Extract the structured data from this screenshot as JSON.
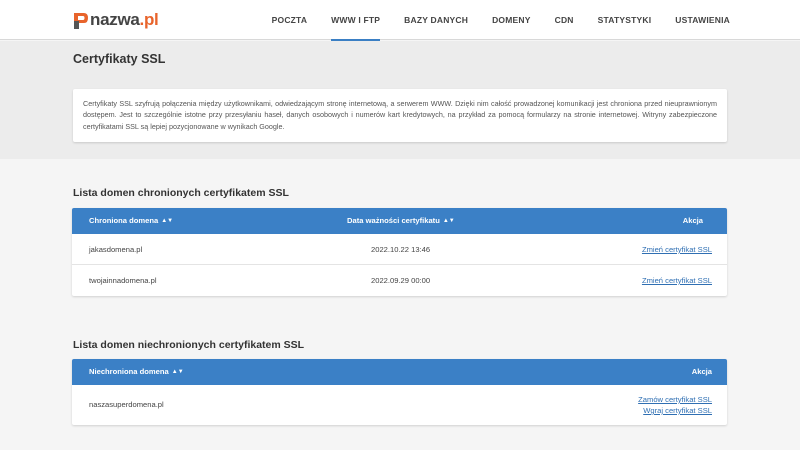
{
  "header": {
    "logo": {
      "name": "nazwa",
      "dot": ".",
      "tld": "pl"
    },
    "nav": [
      {
        "label": "POCZTA",
        "active": false
      },
      {
        "label": "WWW i FTP",
        "active": true
      },
      {
        "label": "BAZY DANYCH",
        "active": false
      },
      {
        "label": "DOMENY",
        "active": false
      },
      {
        "label": "CDN",
        "active": false
      },
      {
        "label": "STATYSTYKI",
        "active": false
      },
      {
        "label": "USTAWIENIA",
        "active": false
      }
    ]
  },
  "page": {
    "title": "Certyfikaty SSL",
    "info": "Certyfikaty SSL szyfrują połączenia między użytkownikami, odwiedzającym stronę internetową, a serwerem WWW. Dzięki nim całość prowadzonej komunikacji jest chroniona przed nieuprawnionym dostępem. Jest to szczególnie istotne przy przesyłaniu haseł, danych osobowych i numerów kart kredytowych, na przykład za pomocą formularzy na stronie internetowej. Witryny zabezpieczone certyfikatami SSL są lepiej pozycjonowane w wynikach Google."
  },
  "protected": {
    "title": "Lista domen chronionych certyfikatem SSL",
    "columns": {
      "domain": "Chroniona domena",
      "expiry": "Data ważności certyfikatu",
      "action": "Akcja"
    },
    "sort_icon": "▲▼",
    "rows": [
      {
        "domain": "jakasdomena.pl",
        "expiry": "2022.10.22 13:46",
        "action": "Zmień certyfikat SSL"
      },
      {
        "domain": "twojainnadomena.pl",
        "expiry": "2022.09.29 00:00",
        "action": "Zmień certyfikat SSL"
      }
    ]
  },
  "unprotected": {
    "title": "Lista domen niechronionych certyfikatem SSL",
    "columns": {
      "domain": "Niechroniona domena",
      "action": "Akcja"
    },
    "rows": [
      {
        "domain": "naszasuperdomena.pl",
        "actions": [
          "Zamów certyfikat SSL",
          "Wgraj certyfikat SSL"
        ]
      }
    ]
  },
  "colors": {
    "accent": "#3b80c6",
    "brand": "#e8642c",
    "link": "#2f6fb3"
  }
}
